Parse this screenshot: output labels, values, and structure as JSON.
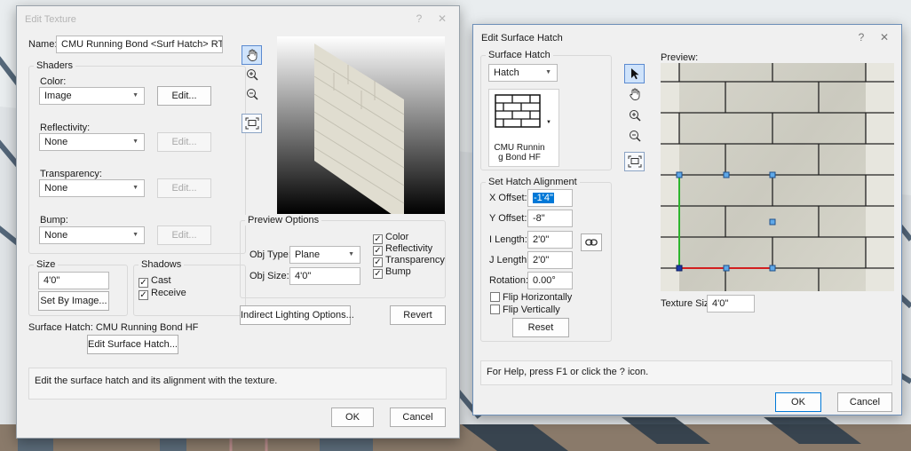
{
  "colors": {
    "accent": "#0078d7",
    "selection": "#cfe3fb",
    "dialog_bg": "#f0f0f0"
  },
  "edit_texture": {
    "title": "Edit Texture",
    "help_glyph": "?",
    "close_glyph": "✕",
    "name_label": "Name:",
    "name_value": "CMU Running Bond <Surf Hatch> RT",
    "shaders_label": "Shaders",
    "color_label": "Color:",
    "color_value": "Image",
    "color_edit": "Edit...",
    "reflectivity_label": "Reflectivity:",
    "reflectivity_value": "None",
    "reflectivity_edit": "Edit...",
    "transparency_label": "Transparency:",
    "transparency_value": "None",
    "transparency_edit": "Edit...",
    "bump_label": "Bump:",
    "bump_value": "None",
    "bump_edit": "Edit...",
    "size_label": "Size",
    "size_value": "4'0\"",
    "set_by_image": "Set By Image...",
    "shadows_label": "Shadows",
    "cast_label": "Cast",
    "cast_checked": true,
    "receive_label": "Receive",
    "receive_checked": true,
    "preview_options_label": "Preview Options",
    "obj_type_label": "Obj Type:",
    "obj_type_value": "Plane",
    "obj_size_label": "Obj Size:",
    "obj_size_value": "4'0\"",
    "preview_color_label": "Color",
    "preview_reflectivity_label": "Reflectivity",
    "preview_transparency_label": "Transparency",
    "preview_bump_label": "Bump",
    "indirect_lighting": "Indirect Lighting Options...",
    "revert": "Revert",
    "surface_hatch_text": "Surface Hatch:  CMU Running Bond HF",
    "edit_surface_hatch": "Edit Surface Hatch...",
    "status_text": "Edit the surface hatch and its alignment with the texture.",
    "ok": "OK",
    "cancel": "Cancel"
  },
  "edit_surface_hatch": {
    "title": "Edit Surface Hatch",
    "help_glyph": "?",
    "close_glyph": "✕",
    "surface_hatch_label": "Surface Hatch",
    "hatch_type_value": "Hatch",
    "hatch_name": "CMU Runnin g Bond HF",
    "set_alignment_label": "Set Hatch Alignment",
    "x_offset_label": "X Offset:",
    "x_offset_value": "-1'4\"",
    "y_offset_label": "Y Offset:",
    "y_offset_value": "-8\"",
    "i_length_label": "I Length:",
    "i_length_value": "2'0\"",
    "j_length_label": "J Length:",
    "j_length_value": "2'0\"",
    "rotation_label": "Rotation:",
    "rotation_value": "0.00°",
    "flip_h_label": "Flip Horizontally",
    "flip_v_label": "Flip Vertically",
    "reset": "Reset",
    "preview_label": "Preview:",
    "texture_size_label": "Texture Size:",
    "texture_size_value": "4'0\"",
    "status_text": "For Help, press F1 or click the ? icon.",
    "ok": "OK",
    "cancel": "Cancel"
  }
}
